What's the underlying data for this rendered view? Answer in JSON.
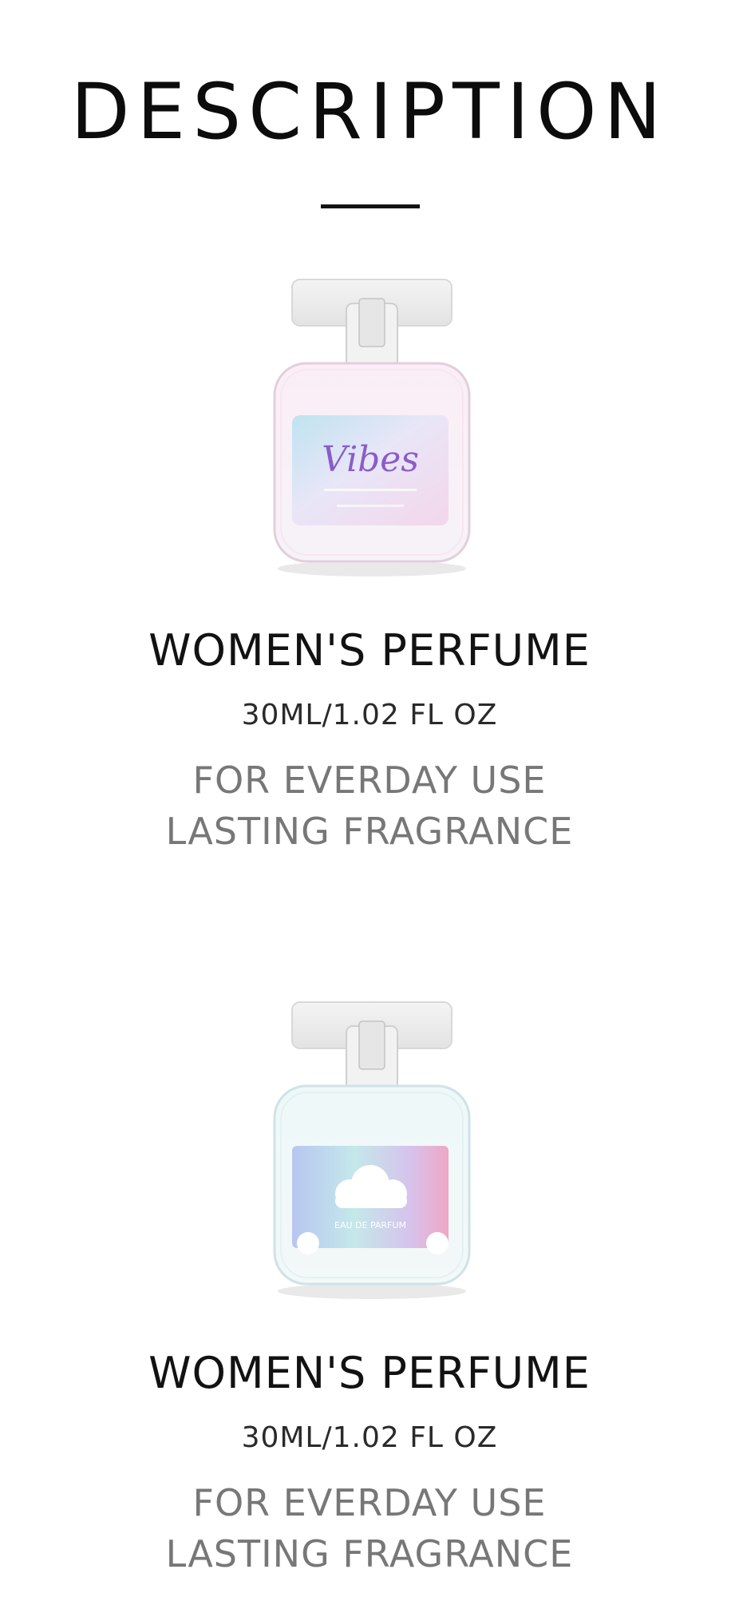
{
  "header": {
    "title": "DESCRIPTION"
  },
  "products": [
    {
      "image": "perfume-bottle-vibes",
      "label_text": "Vibes",
      "name": "WOMEN'S PERFUME",
      "size": "30ML/1.02 FL OZ",
      "features": [
        "FOR EVERDAY USE",
        "LASTING FRAGRANCE"
      ]
    },
    {
      "image": "perfume-bottle-cloud",
      "label_text": "EAU DE PARFUM",
      "name": "WOMEN'S PERFUME",
      "size": "30ML/1.02 FL OZ",
      "features": [
        "FOR EVERDAY USE",
        "LASTING FRAGRANCE"
      ]
    }
  ],
  "colors": {
    "text": "#111111",
    "muted_text": "#777777",
    "vibes_label": "#8a5cc8",
    "bottle_pink_tint": "#f3d9ea",
    "bottle_blue_tint": "#d9eef0"
  }
}
